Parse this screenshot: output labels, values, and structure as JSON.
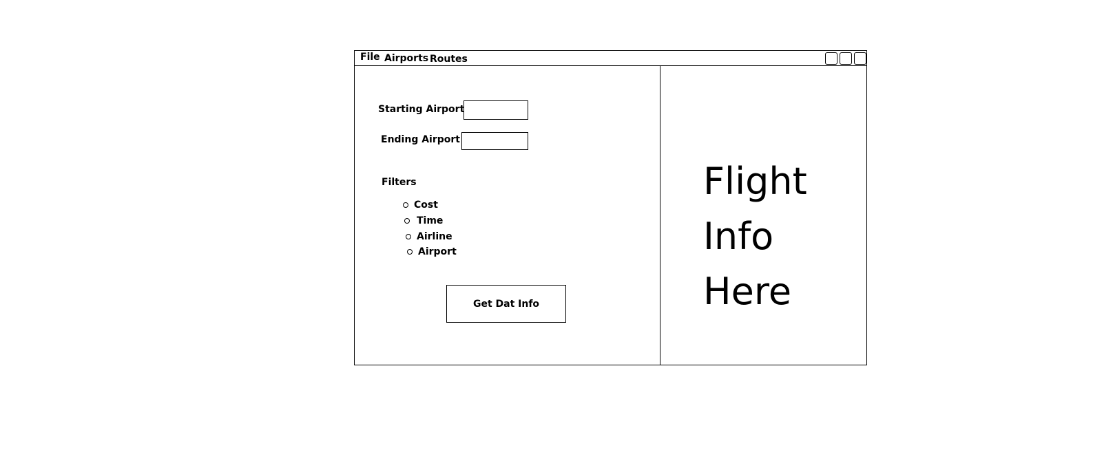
{
  "menubar": {
    "items": [
      {
        "label": "File"
      },
      {
        "label": "Airports"
      },
      {
        "label": "Routes"
      }
    ]
  },
  "form": {
    "starting_airport_label": "Starting Airport",
    "starting_airport_value": "",
    "ending_airport_label": "Ending Airport",
    "ending_airport_value": "",
    "filters_label": "Filters",
    "filters": [
      {
        "label": "Cost"
      },
      {
        "label": "Time"
      },
      {
        "label": "Airline"
      },
      {
        "label": "Airport"
      }
    ],
    "submit_label": "Get Dat Info"
  },
  "info_panel": {
    "lines": [
      "Flight",
      "Info",
      "Here"
    ]
  }
}
